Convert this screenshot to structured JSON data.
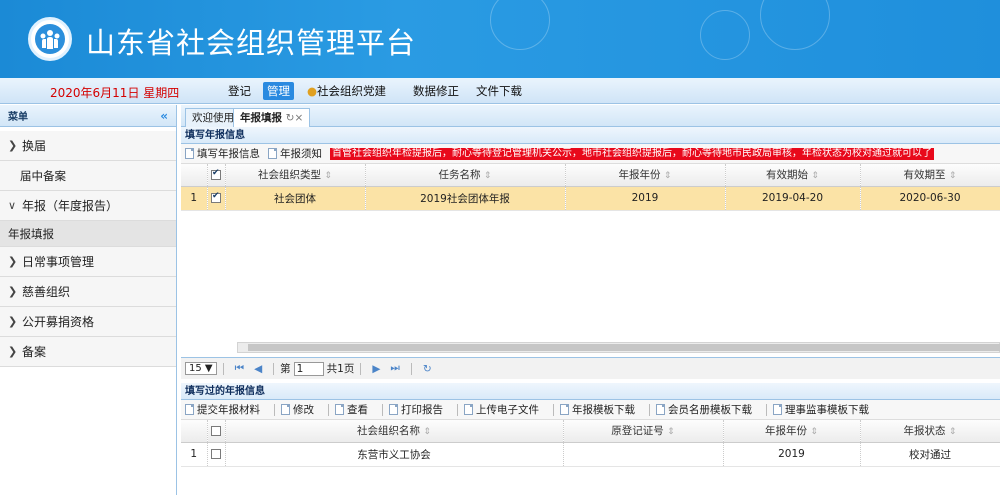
{
  "header": {
    "title": "山东省社会组织管理平台",
    "date": "2020年6月11日 星期四",
    "nav": [
      {
        "label": "登记",
        "active": false
      },
      {
        "label": "管理",
        "active": true
      },
      {
        "label": "社会组织党建",
        "active": false
      },
      {
        "label": "数据修正",
        "active": false
      },
      {
        "label": "文件下载",
        "active": false
      }
    ]
  },
  "sidebar": {
    "title": "菜单",
    "collapse_icon": "«",
    "items": [
      {
        "label": "换届",
        "type": "group",
        "expanded": false
      },
      {
        "label": "届中备案",
        "type": "sub"
      },
      {
        "label": "年报（年度报告）",
        "type": "group",
        "expanded": true
      },
      {
        "label": "年报填报",
        "type": "sub",
        "selected": true
      },
      {
        "label": "日常事项管理",
        "type": "group",
        "expanded": false
      },
      {
        "label": "慈善组织",
        "type": "group",
        "expanded": false
      },
      {
        "label": "公开募捐资格",
        "type": "group",
        "expanded": false
      },
      {
        "label": "备案",
        "type": "group",
        "expanded": false
      }
    ]
  },
  "tabs": [
    {
      "label": "欢迎使用",
      "active": false
    },
    {
      "label": "年报填报",
      "active": true,
      "refresh_icon": "↻",
      "close_icon": "×"
    }
  ],
  "panel1": {
    "title": "填写年报信息",
    "toolbar": [
      "填写年报信息",
      "年报须知"
    ],
    "notice": "首管社会组织年检提报后，耐心等待登记管理机关公示，地市社会组织提报后，耐心等待地市民政局审核，年检状态为校对通过就可以了",
    "columns": [
      "社会组织类型",
      "任务名称",
      "年报年份",
      "有效期始",
      "有效期至"
    ],
    "rows": [
      {
        "num": "1",
        "checked": true,
        "cells": [
          "社会团体",
          "2019社会团体年报",
          "2019",
          "2019-04-20",
          "2020-06-30"
        ]
      }
    ],
    "pager": {
      "page_size": "15",
      "page_label": "第",
      "page": "1",
      "total": "共1页"
    }
  },
  "panel2": {
    "title": "填写过的年报信息",
    "toolbar": [
      "提交年报材料",
      "修改",
      "查看",
      "打印报告",
      "上传电子文件",
      "年报模板下载",
      "会员名册模板下载",
      "理事监事模板下载"
    ],
    "columns": [
      "社会组织名称",
      "原登记证号",
      "年报年份",
      "年报状态"
    ],
    "rows": [
      {
        "num": "1",
        "checked": false,
        "cells": [
          "东营市义工协会",
          "",
          "2019",
          "校对通过"
        ]
      }
    ]
  },
  "colors": {
    "banner": "#1b8ad6",
    "notice_bg": "#e8091b",
    "highlight_row": "#fbe3a6",
    "nav_active": "#2a8ae0"
  }
}
